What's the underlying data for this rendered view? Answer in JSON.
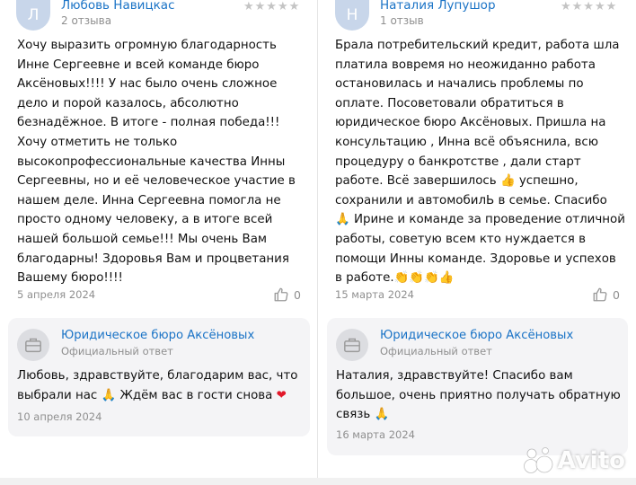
{
  "left": {
    "reviewer": {
      "initial": "Л",
      "name": "Любовь Навицкас",
      "count": "2 отзыва",
      "stars": "★★★★★"
    },
    "review_lines": [
      "Хочу выразить огромную благодарность",
      "Инне Сергеевне и всей команде бюро",
      "Аксёновых!!!! У нас было очень сложное",
      "дело и порой казалось, абсолютно",
      "безнадёжное. В итоге - полная победа!!!",
      "Хочу отметить не только",
      "высокопрофессиональные качества Инны",
      "Сергеевны, но и её человеческое участие в",
      "нашем деле. Инна Сергеевна помогла не",
      "просто одному человеку, а в итоге всей",
      "нашей большой семье!!! Мы очень Вам",
      "благодарны! Здоровья Вам и процветания",
      "Вашему бюро!!!!"
    ],
    "date": "5 апреля 2024",
    "likes": "0",
    "reply": {
      "org_name": "Юридическое бюро Аксёновых",
      "org_sub": "Официальный ответ",
      "line1": "Любовь, здравствуйте, благодарим вас, что",
      "line2_a": "выбрали нас ",
      "emoji": "🙏",
      "line2_b": " Ждём вас в гости снова ",
      "heart": "❤",
      "date": "10 апреля 2024"
    }
  },
  "right": {
    "reviewer": {
      "initial": "Н",
      "name": "Наталия Лупушор",
      "count": "1 отзыв",
      "stars": "★★★★★"
    },
    "review_lines": [
      "Брала потребительский кредит, работа шла",
      "платила вовремя но неожиданно работа",
      "остановилась и начались проблемы по",
      "оплате. Посоветовали обратиться в",
      "юридическое бюро Аксёновых. Пришла на",
      "консультацию , Инна всё объяснила, всю",
      "процедуру о банкротстве , дали старт",
      "работе. Всё завершилось",
      "сохранили и автомобилЬ в семье. Спасибо",
      "Ирине и команде за проведение отличной",
      "работы, советую всем кто нуждается в",
      "помощи Инны команде. Здоровье и успехов",
      "в работе."
    ],
    "thumb_emoji": "👍",
    "after_thumb": " успешно,",
    "pray_emoji": "🙏",
    "claps": "👏👏👏👍",
    "date": "15 марта 2024",
    "likes": "0",
    "reply": {
      "org_name": "Юридическое бюро Аксёновых",
      "org_sub": "Официальный ответ",
      "line1": "Наталия, здравствуйте! Спасибо вам",
      "line2": "большое, очень приятно получать обратную",
      "line3": "связь ",
      "emoji": "🙏",
      "date": "16 марта 2024"
    }
  },
  "watermark": "Avito",
  "icons": {
    "like": "thumb-up-icon",
    "org": "briefcase-icon",
    "logo": "avito-logo-icon"
  }
}
